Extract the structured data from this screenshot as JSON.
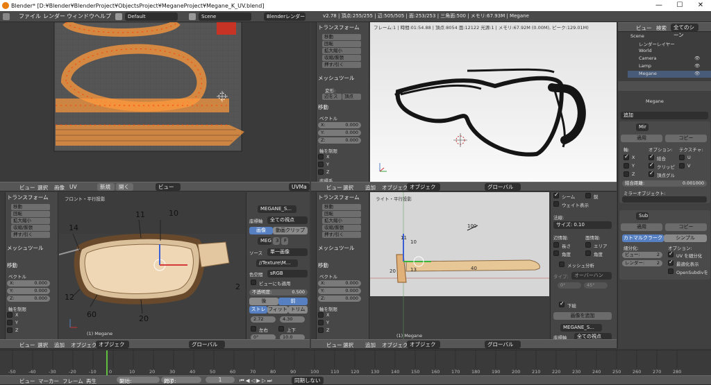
{
  "window": {
    "title": "Blender* [D:¥Blender¥BlenderProject¥ObjectsProject¥MeganeProject¥Megane_K_UV.blend]",
    "minimize": "—",
    "maximize": "☐",
    "close": "✕"
  },
  "topbar": {
    "menus": [
      "ファイル",
      "レンダー",
      "ウィンドウ",
      "ヘルプ"
    ],
    "layout": "Default",
    "scene": "Scene",
    "engine": "Blenderレンダー",
    "stats": "v2.78 | 頂点:255/255 | 辺:505/505 | 面:253/253 | 三角面:500 | メモリ:67.93M | Megane"
  },
  "outliner": {
    "tabs": [
      "ビュー",
      "検索",
      "全てのシーン"
    ],
    "items": [
      "Scene",
      "レンダーレイヤー",
      "World",
      "Camera",
      "Lamp",
      "Megane"
    ]
  },
  "view3d_top_right": {
    "info": "フレーム:1 | 時間:01:54.88 | 頂点:8054 面:12122 光源:1 | メモリ:67.92M (0.00M), ピーク:129.01M)"
  },
  "tool_panel_a": {
    "section_transform": "トランスフォーム",
    "buttons": [
      "移動",
      "回転",
      "拡大縮小",
      "収縮/膨張",
      "押す/引く"
    ],
    "section_mesh": "メッシュツール",
    "deform": "変形:",
    "slide_edge": "辺をス",
    "slide_vertex": "頂点",
    "section_move": "移動",
    "vector": "ベクトル",
    "x": "X:",
    "y": "Y:",
    "z": "Z:",
    "val": "0.000",
    "constraint": "軸を制限",
    "ax_x": "X",
    "ax_y": "Y",
    "ax_z": "Z",
    "orient": "座標系"
  },
  "header_mid": {
    "left_menus": [
      "ビュー",
      "選択",
      "画像",
      "UV"
    ],
    "new": "新規",
    "open": "開く",
    "view": "ビュー",
    "uvmap": "UVMa",
    "right_menus": [
      "ビュー",
      "選択",
      "追加",
      "オブジェクト"
    ],
    "mode": "オブジェクトモード",
    "global": "グローバル"
  },
  "image_editor": {
    "label": "フロント・平行投影",
    "object": "(1) Megane",
    "callouts": [
      "10",
      "11",
      "14",
      "12",
      "60",
      "20",
      "2"
    ]
  },
  "image_props": {
    "image_name": "MEGANE_S...",
    "coord_label": "座標軸",
    "coord_value": "全ての視点",
    "tab_image": "画像",
    "tab_clip": "動画クリップ",
    "meg": "MEG",
    "num": "3",
    "f": "F",
    "source_label": "ソース",
    "source_value": "単一画像",
    "path": "//Texture\\M...",
    "colorspace_label": "色空間",
    "colorspace": "sRGB",
    "view_apply": "ビューにも適用",
    "opacity_label": "不透明度:",
    "opacity": "0.500",
    "back": "後",
    "front": "前",
    "fit": [
      "ストレ",
      "フィット",
      "トリム"
    ],
    "val1": "2.72",
    "val2": "4.30",
    "left": "左右",
    "updown": "上下",
    "zero": "0°",
    "ten": "10.0"
  },
  "view3d_side": {
    "label": "ライト・平行投影",
    "object": "(1) Megane",
    "callouts": [
      "100",
      "11",
      "10",
      "20",
      "13",
      "40"
    ]
  },
  "modifier_mid": {
    "seam": "シーム",
    "sharp": "鋭",
    "weight": "ウェイト表示",
    "normal": "法線:",
    "size_label": "サイズ: 0.10",
    "edge_info": "辺情報:",
    "face_info": "面情報:",
    "length": "長さ",
    "area": "エリア",
    "angle": "角度",
    "angle2": "角度",
    "mesh_analysis": "メッシュ分析",
    "type_label": "タイプ:",
    "type_value": "オーバーハン",
    "deg0": "0°",
    "deg45": "45°",
    "bottom": "下絵",
    "add_image": "画像を追加",
    "image_name": "MEGANE_S...",
    "coord": "座標軸",
    "coord_value": "全ての視点"
  },
  "properties": {
    "object": "Megane",
    "add": "追加",
    "mirror_name": "Mir",
    "apply": "適用",
    "copy": "コピー",
    "axis": "軸:",
    "options": "オプション:",
    "texture": "テクスチャ:",
    "x": "X",
    "y": "Y",
    "z": "Z",
    "merge": "結合",
    "clip": "クリッピ",
    "vgroup": "頂点グル",
    "u": "U",
    "v": "V",
    "merge_dist": "結合距離:",
    "merge_val": "0.001000",
    "mirror_obj": "ミラーオブジェクト:",
    "subsurf": "Sub",
    "catmull": "カトマルクラーク",
    "simple": "シンプル",
    "subdiv": "細分化:",
    "view_label": "ビュー:",
    "view_val": "2",
    "render_label": "レンダー:",
    "render_val": "2",
    "opts": "オプション:",
    "uv_sub": "UV を細分化",
    "opt_draw": "最適化表示",
    "osd": "OpenSubdivを"
  },
  "timeline": {
    "ticks": [
      "-50",
      "-40",
      "-30",
      "-20",
      "-10",
      "0",
      "10",
      "20",
      "30",
      "40",
      "50",
      "60",
      "70",
      "80",
      "90",
      "100",
      "110",
      "120",
      "130",
      "140",
      "150",
      "160",
      "170",
      "180",
      "190",
      "200",
      "210",
      "220",
      "230",
      "240",
      "250",
      "260",
      "270",
      "280"
    ],
    "menus": [
      "ビュー",
      "マーカー",
      "フレーム",
      "再生"
    ],
    "start_label": "開始:",
    "start": "1",
    "end_label": "終了:",
    "end": "250",
    "current": "1",
    "sync": "同期しない"
  },
  "colors": {
    "accent": "#5680c2",
    "vertex": "#ff3d00",
    "edge_sel": "#ff9a3c"
  }
}
